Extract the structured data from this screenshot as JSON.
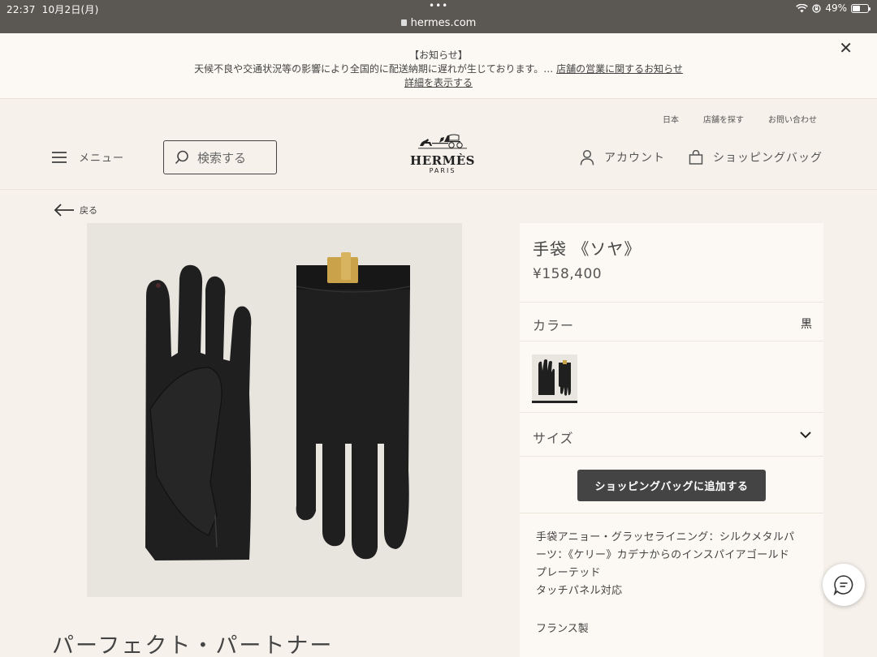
{
  "status_bar": {
    "time": "22:37",
    "date": "10月2日(月)",
    "url": "hermes.com",
    "battery": "49%",
    "battery_level": 0.49
  },
  "notice": {
    "heading": "【お知らせ】",
    "body": "天候不良や交通状況等の影響により全国的に配送納期に遅れが生じております。… ",
    "link_stores": "店舗の営業に関するお知らせ",
    "link_details": "詳細を表示する"
  },
  "header": {
    "top_links": [
      "日本",
      "店舗を探す",
      "お問い合わせ"
    ],
    "menu_label": "メニュー",
    "search_placeholder": "検索する",
    "logo_word": "HERMÈS",
    "logo_sub": "PARIS",
    "account_label": "アカウント",
    "bag_label": "ショッピングバッグ"
  },
  "back_label": "戻る",
  "page_heading": "パーフェクト・パートナー",
  "product": {
    "title": "手袋 《ソヤ》",
    "price": "¥158,400",
    "color_label": "カラー",
    "color_value": "黒",
    "size_label": "サイズ",
    "add_to_bag": "ショッピングバッグに追加する",
    "description_lines": [
      "手袋アニョー・グラッセライニング：シルクメタルパ",
      "ーツ：《ケリー》カデナからのインスパイアゴールド",
      "プレーテッド",
      "タッチパネル対応"
    ],
    "made_in": "フランス製"
  },
  "colors": {
    "status_bar_bg": "#5b5753",
    "page_bg": "#f6f1eb",
    "panel_bg": "#fcf9f4",
    "button_bg": "#444444",
    "glove": "#1f1f1f",
    "gold": "#c9a24a"
  }
}
